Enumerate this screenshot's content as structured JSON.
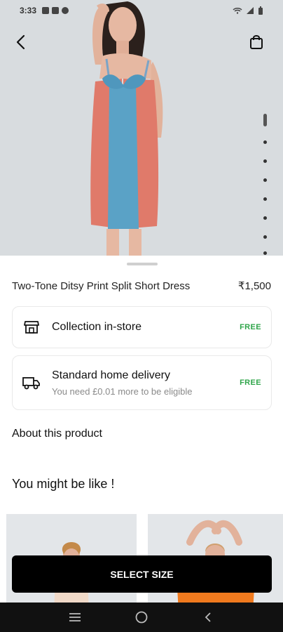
{
  "status_bar": {
    "time": "3:33",
    "icons_left": [
      "grid-icon",
      "youtube-icon",
      "phone-icon"
    ],
    "icons_right": [
      "wifi-icon",
      "signal-icon",
      "battery-icon"
    ]
  },
  "header": {
    "back_icon": "back-arrow-icon",
    "bag_icon": "shopping-bag-icon"
  },
  "gallery": {
    "image_count": 8,
    "active_index": 0
  },
  "product": {
    "title": "Two-Tone Ditsy Print Split Short Dress",
    "price": "₹1,500"
  },
  "delivery": [
    {
      "icon": "store-icon",
      "label": "Collection in-store",
      "sublabel": "",
      "badge": "FREE"
    },
    {
      "icon": "truck-icon",
      "label": "Standard home delivery",
      "sublabel": "You need £0.01 more to be eligible",
      "badge": "FREE"
    }
  ],
  "about_label": "About this product",
  "recommend_heading": "You might be like !",
  "cta_label": "SELECT SIZE",
  "colors": {
    "accent_free": "#2fa54a",
    "cta_bg": "#000000",
    "hero_bg": "#d8dcdf"
  }
}
